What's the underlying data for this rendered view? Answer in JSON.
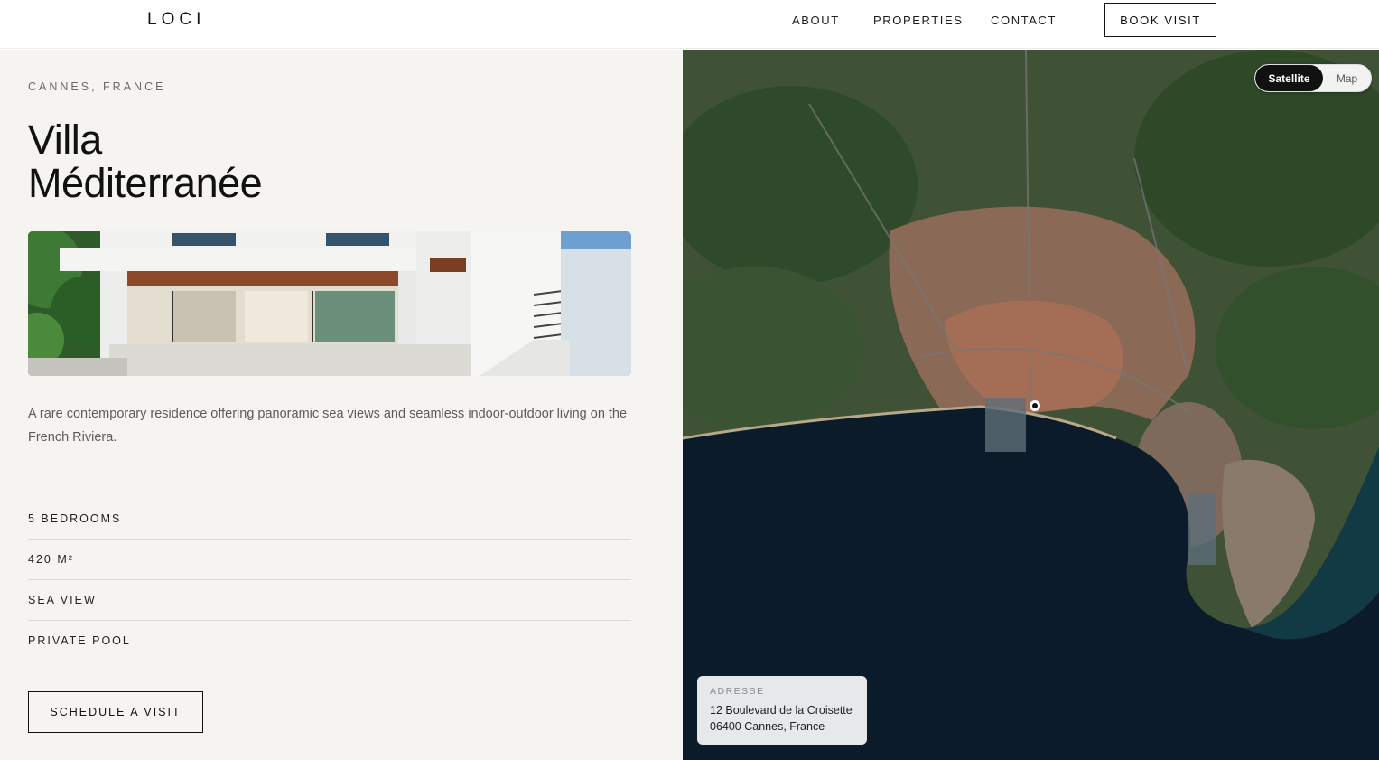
{
  "header": {
    "logo": "LOCI",
    "nav": [
      "ABOUT",
      "PROPERTIES",
      "CONTACT"
    ],
    "cta": "BOOK VISIT"
  },
  "listing": {
    "location": "CANNES, FRANCE",
    "title_line1": "Villa",
    "title_line2": "Méditerranée",
    "description": "A rare contemporary residence offering panoramic sea views and seamless indoor-outdoor living on the French Riviera.",
    "features": [
      "5 BEDROOMS",
      "420 M²",
      "SEA VIEW",
      "PRIVATE POOL"
    ],
    "cta": "SCHEDULE A VISIT"
  },
  "map": {
    "toggle": {
      "satellite": "Satellite",
      "map": "Map",
      "active": "Satellite"
    },
    "address_label": "ADRESSE",
    "address_line1": "12 Boulevard de la Croisette",
    "address_line2": "06400 Cannes, France"
  },
  "colors": {
    "panel_bg": "#f5f4f1",
    "text_dark": "#111111",
    "text_muted": "#5b5b5b",
    "sea": "#0d1a24",
    "land": "#4a5a3c",
    "city": "#9a6a55"
  }
}
